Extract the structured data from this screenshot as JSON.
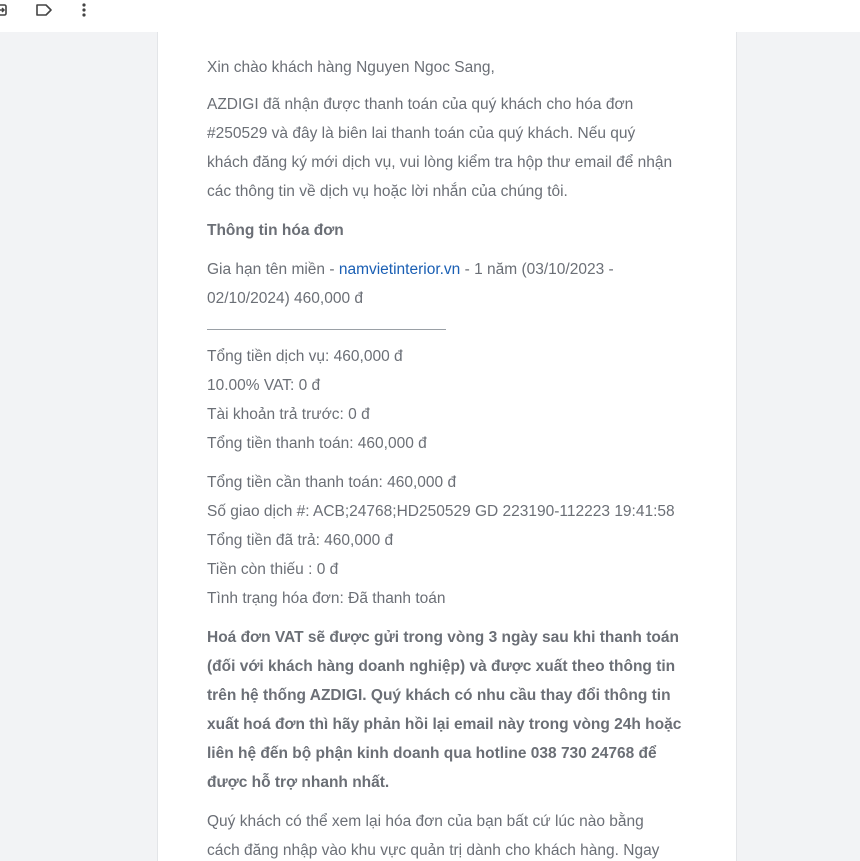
{
  "toolbar": {
    "icons": [
      "move-to-icon",
      "label-icon",
      "more-vertical-icon"
    ]
  },
  "email": {
    "greeting": "Xin chào khách hàng Nguyen Ngoc Sang,",
    "intro_lines": [
      "AZDIGI đã nhận được thanh toán của quý khách cho hóa đơn",
      "#250529 và đây là biên lai thanh toán của quý khách. Nếu quý",
      "khách đăng ký mới dịch vụ, vui lòng kiểm tra hộp thư email để nhận",
      "các thông tin về dịch vụ hoặc lời nhắn của chúng tôi."
    ],
    "invoice_heading": "Thông tin hóa đơn",
    "item_prefix": "Gia hạn tên miền - ",
    "item_domain": "namvietinterior.vn",
    "item_suffix": " - 1 năm (03/10/2023 -",
    "item_line2": "02/10/2024) 460,000 đ",
    "divider_text": "",
    "totals": [
      "Tổng tiền dịch vụ: 460,000 đ",
      "10.00% VAT: 0 đ",
      "Tài khoản trả trước: 0 đ",
      "Tổng tiền thanh toán: 460,000 đ"
    ],
    "payment": [
      "Tổng tiền cần thanh toán: 460,000 đ",
      "Số giao dịch #: ACB;24768;HD250529 GD 223190-112223 19:41:58",
      "Tổng tiền đã trả: 460,000 đ",
      "Tiền còn thiếu : 0 đ",
      "Tình trạng hóa đơn: Đã thanh toán"
    ],
    "vat_notice": [
      "Hoá đơn VAT sẽ được gửi trong vòng 3 ngày sau khi thanh toán",
      "(đối với khách hàng doanh nghiệp) và được xuất theo thông tin",
      "trên hệ thống AZDIGI. Quý khách có nhu cầu thay đổi thông tin",
      "xuất hoá đơn thì hãy phản hồi lại email này trong vòng 24h hoặc",
      "liên hệ đến bộ phận kinh doanh qua hotline 038 730 24768 để",
      "được hỗ trợ nhanh nhất."
    ],
    "closing": [
      "Quý khách có thể xem lại hóa đơn của bạn bất cứ lúc nào bằng",
      "cách đăng nhập vào khu vực quản trị dành cho khách hàng. Ngay"
    ]
  }
}
